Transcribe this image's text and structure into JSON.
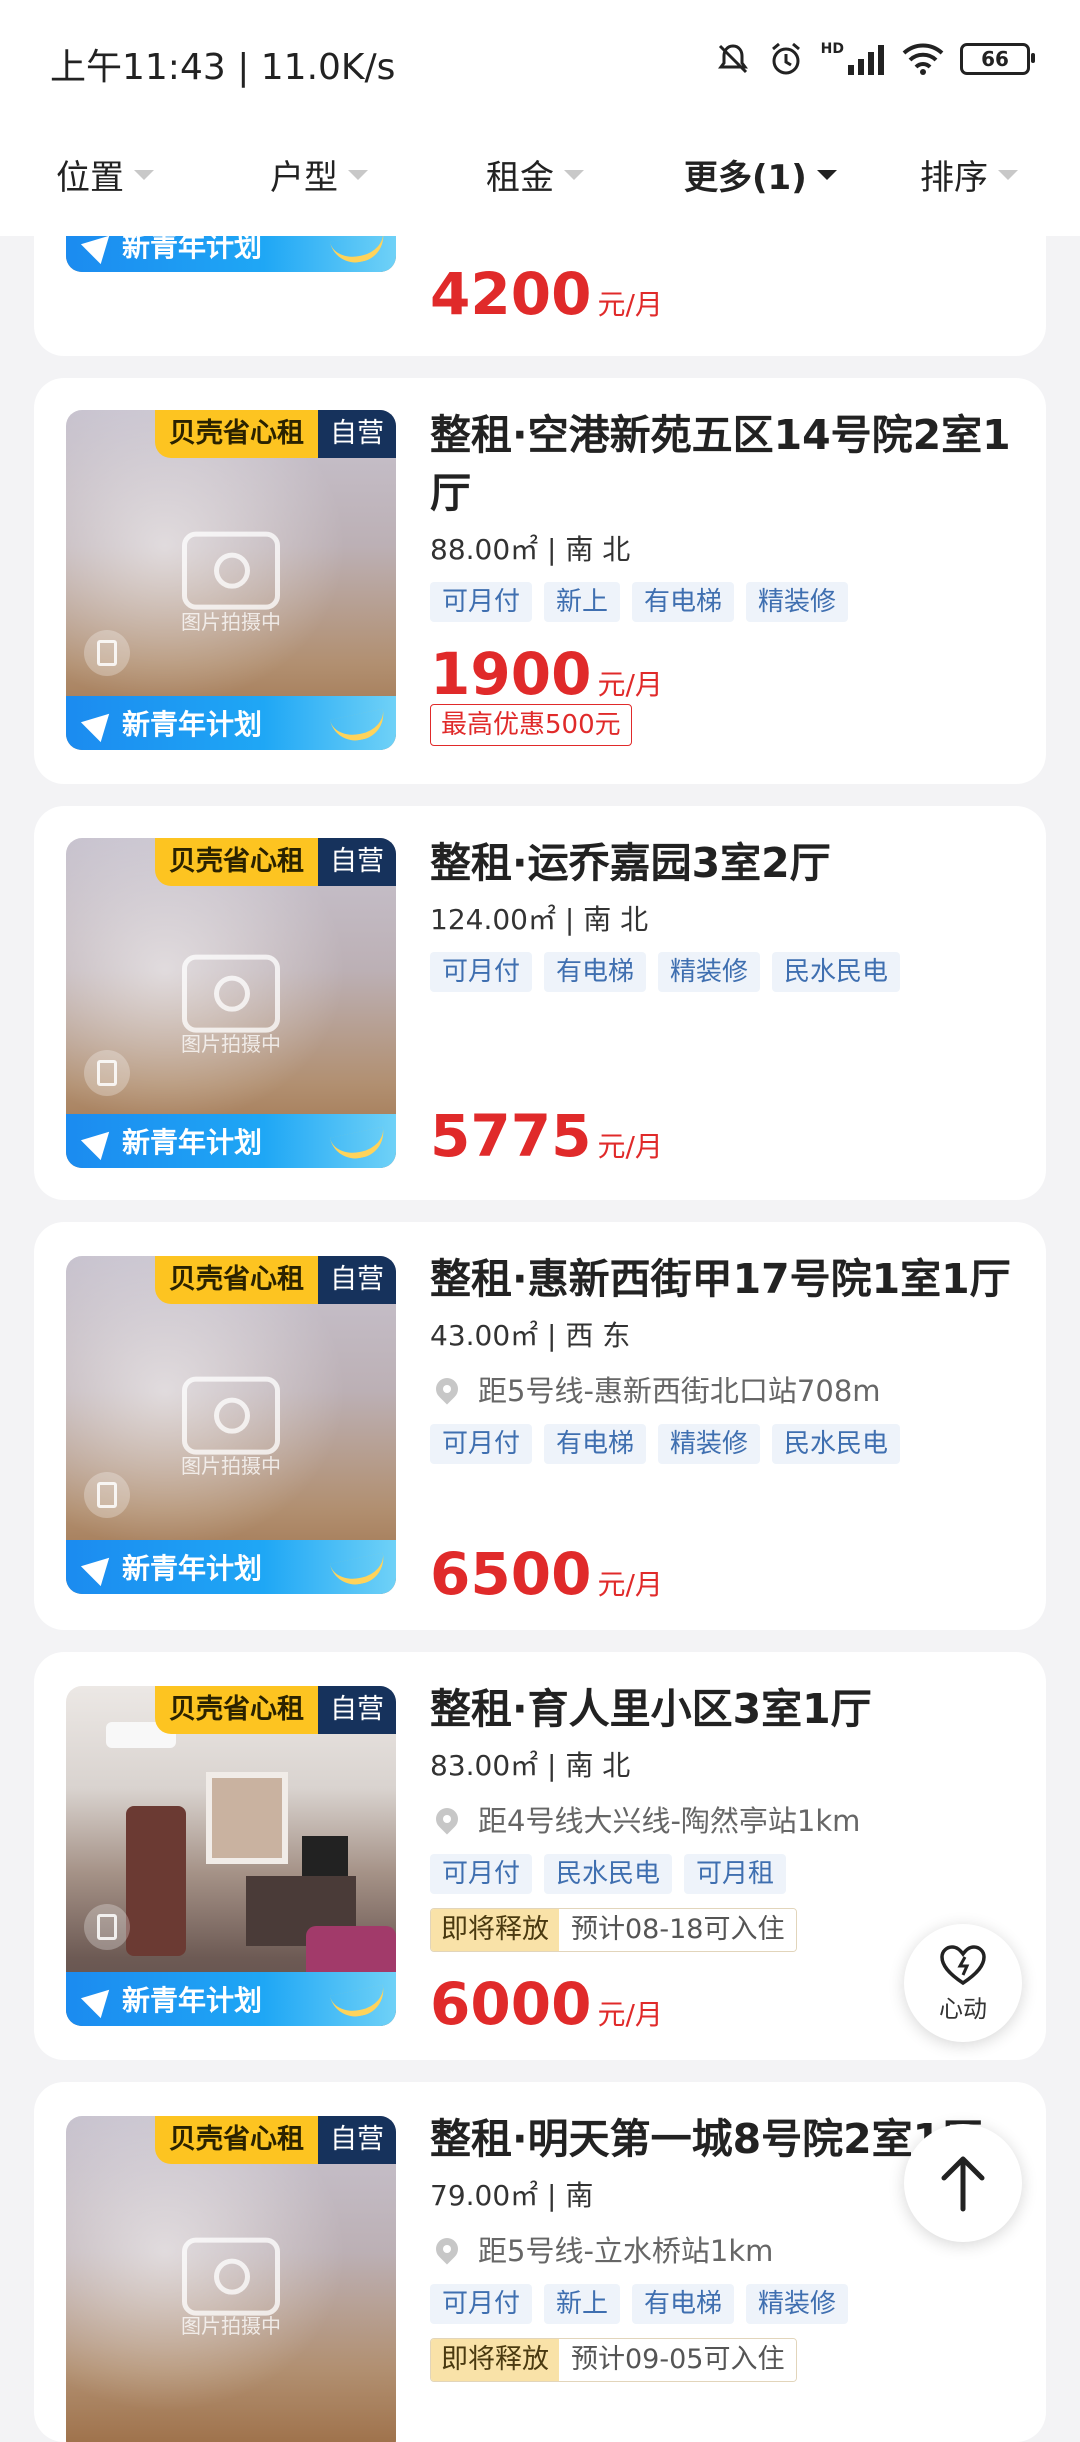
{
  "status_bar": {
    "time_speed": "上午11:43 | 11.0K/s",
    "hd_label": "HD",
    "battery": "66"
  },
  "filters": [
    {
      "label": "位置"
    },
    {
      "label": "户型"
    },
    {
      "label": "租金"
    },
    {
      "label": "更多(1)"
    },
    {
      "label": "排序"
    }
  ],
  "common": {
    "badge_yellow": "贝壳省心租",
    "badge_navy": "自营",
    "banner": "新青年计划",
    "photo_placeholder": "图片拍摄中",
    "price_unit": "元/月"
  },
  "listings": [
    {
      "price": "4200"
    },
    {
      "title": "整租·空港新苑五区14号院2室1厅",
      "spec": "88.00㎡ | 南 北",
      "tags": [
        "可月付",
        "新上",
        "有电梯",
        "精装修"
      ],
      "price": "1900",
      "promo": "最高优惠500元"
    },
    {
      "title": "整租·运乔嘉园3室2厅",
      "spec": "124.00㎡ | 南 北",
      "tags": [
        "可月付",
        "有电梯",
        "精装修",
        "民水民电"
      ],
      "price": "5775"
    },
    {
      "title": "整租·惠新西街甲17号院1室1厅",
      "spec": "43.00㎡ | 西 东",
      "location": "距5号线-惠新西街北口站708m",
      "tags": [
        "可月付",
        "有电梯",
        "精装修",
        "民水民电"
      ],
      "price": "6500"
    },
    {
      "title": "整租·育人里小区3室1厅",
      "spec": "83.00㎡ | 南 北",
      "location": "距4号线大兴线-陶然亭站1km",
      "tags": [
        "可月付",
        "民水民电",
        "可月租"
      ],
      "release_tag": "即将释放",
      "release_date": "预计08-18可入住",
      "price": "6000"
    },
    {
      "title": "整租·明天第一城8号院2室1厅",
      "spec": "79.00㎡ | 南",
      "location": "距5号线-立水桥站1km",
      "tags": [
        "可月付",
        "新上",
        "有电梯",
        "精装修"
      ],
      "release_tag": "即将释放",
      "release_date": "预计09-05可入住"
    }
  ],
  "fab": {
    "favorite_label": "心动"
  }
}
